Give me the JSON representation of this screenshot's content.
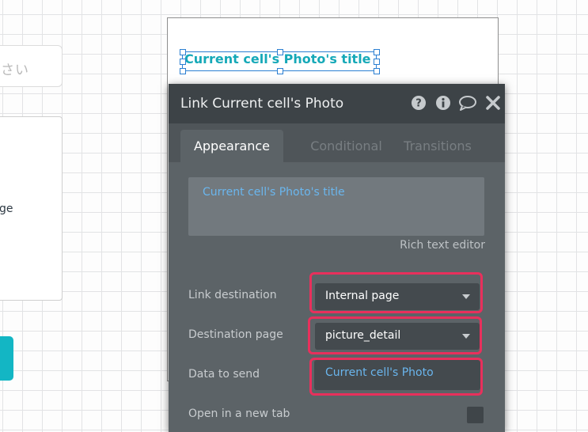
{
  "background": {
    "left_input_text": "さい",
    "left_card_text": "ge"
  },
  "canvas": {
    "selected_element_text": "Current cell's Photo's title"
  },
  "property_editor": {
    "title": "Link Current cell's Photo",
    "header_icons": [
      "help-icon",
      "info-icon",
      "comment-icon",
      "close-icon"
    ],
    "tabs": [
      {
        "label": "Appearance",
        "active": true
      },
      {
        "label": "Conditional",
        "active": false
      },
      {
        "label": "Transitions",
        "active": false
      }
    ],
    "text_content": "Current cell's Photo's title",
    "rich_text_label": "Rich text editor",
    "fields": {
      "link_destination": {
        "label": "Link destination",
        "value": "Internal page"
      },
      "destination_page": {
        "label": "Destination page",
        "value": "picture_detail"
      },
      "data_to_send": {
        "label": "Data to send",
        "value": "Current cell's Photo"
      },
      "open_new_tab": {
        "label": "Open in a new tab"
      }
    }
  },
  "colors": {
    "highlight": "#e8305c",
    "dynamic_text": "#6ab6ee",
    "accent_teal": "#16a9b8"
  }
}
